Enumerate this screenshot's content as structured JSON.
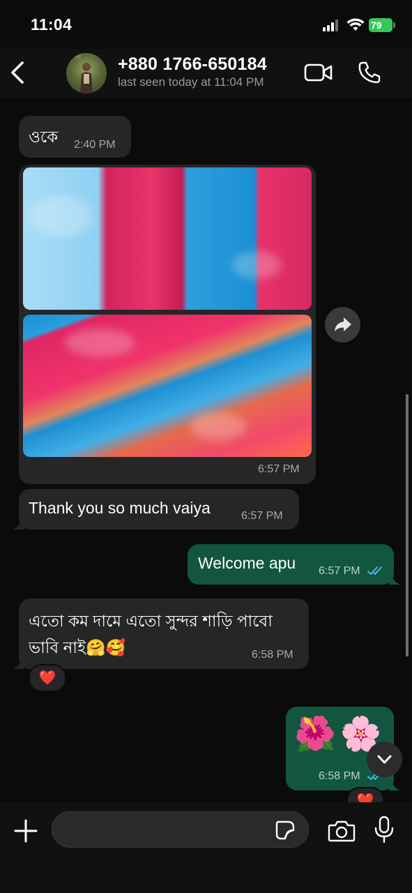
{
  "status_bar": {
    "time": "11:04",
    "battery": "79"
  },
  "header": {
    "contact_name": "+880 1766-650184",
    "last_seen": "last seen today at 11:04 PM"
  },
  "messages": [
    {
      "direction": "incoming",
      "text": "ওকে",
      "time": "2:40 PM"
    },
    {
      "direction": "incoming",
      "type": "photo-album",
      "photo_count": 2,
      "time": "6:57 PM"
    },
    {
      "direction": "incoming",
      "text": "Thank you so much vaiya",
      "time": "6:57 PM"
    },
    {
      "direction": "outgoing",
      "text": "Welcome apu",
      "time": "6:57 PM",
      "status": "read"
    },
    {
      "direction": "incoming",
      "text_line1": "এতো কম দামে এতো সুন্দর শাড়ি পাবো",
      "text_line2": "ভাবি নাই🤗🥰",
      "time": "6:58 PM",
      "reaction": "❤️"
    },
    {
      "direction": "outgoing",
      "text": "🌺🌸",
      "time": "6:58 PM",
      "status": "read",
      "reaction": "❤️"
    }
  ],
  "input": {
    "placeholder": ""
  },
  "colors": {
    "incoming_bubble": "#262628",
    "outgoing_bubble": "#125640",
    "read_ticks": "#53bdeb",
    "battery": "#34c759"
  },
  "icons": [
    "back-icon",
    "video-call-icon",
    "phone-icon",
    "forward-icon",
    "chevron-down-icon",
    "plus-icon",
    "sticker-icon",
    "camera-icon",
    "mic-icon"
  ]
}
